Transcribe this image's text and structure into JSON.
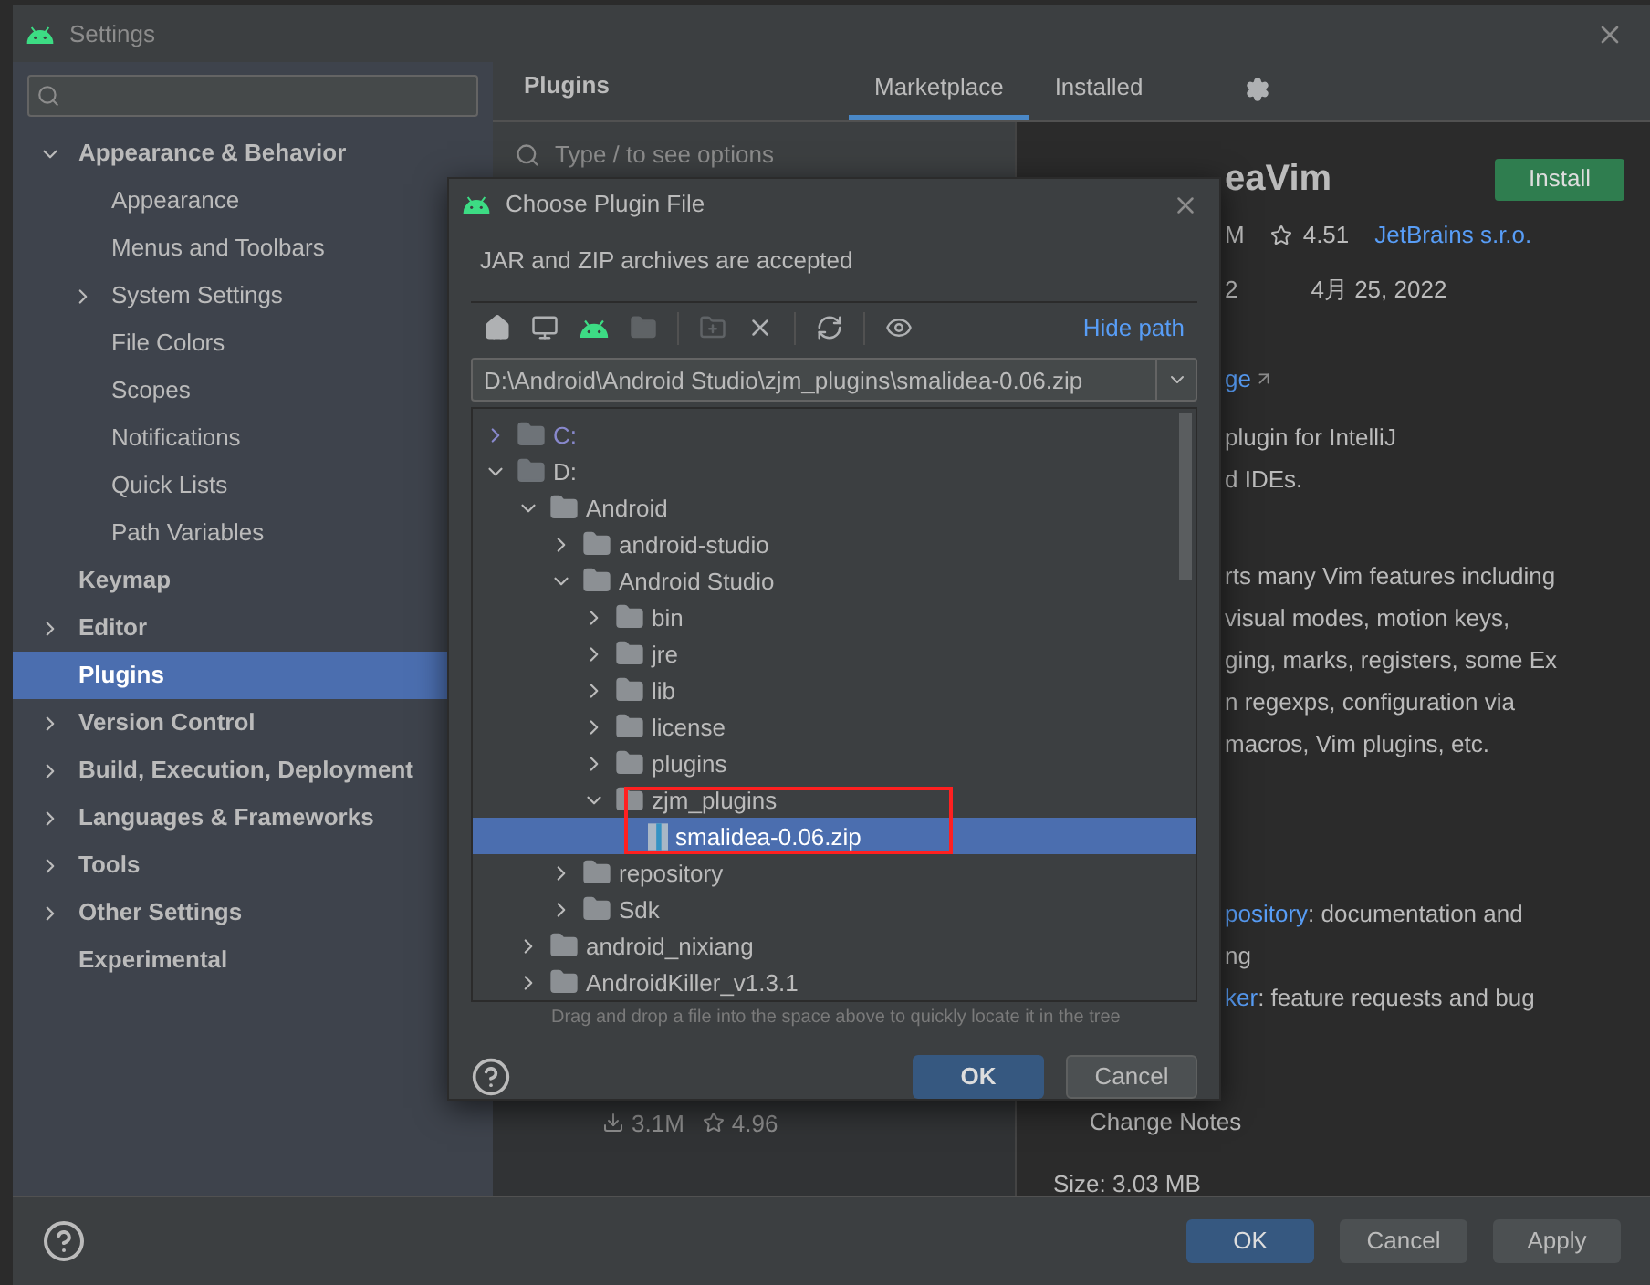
{
  "window": {
    "title": "Settings"
  },
  "sidebar": {
    "items": [
      {
        "label": "Appearance & Behavior",
        "expanded": true,
        "selected": false,
        "children": [
          {
            "label": "Appearance",
            "selected": false
          },
          {
            "label": "Menus and Toolbars",
            "selected": false
          },
          {
            "label": "System Settings",
            "expanded": false,
            "selected": false
          },
          {
            "label": "File Colors",
            "selected": false
          },
          {
            "label": "Scopes",
            "selected": false
          },
          {
            "label": "Notifications",
            "selected": false
          },
          {
            "label": "Quick Lists",
            "selected": false
          },
          {
            "label": "Path Variables",
            "selected": false
          }
        ]
      },
      {
        "label": "Keymap",
        "selected": false
      },
      {
        "label": "Editor",
        "expanded": false,
        "selected": false
      },
      {
        "label": "Plugins",
        "selected": true
      },
      {
        "label": "Version Control",
        "expanded": false,
        "selected": false
      },
      {
        "label": "Build, Execution, Deployment",
        "expanded": false,
        "selected": false
      },
      {
        "label": "Languages & Frameworks",
        "expanded": false,
        "selected": false
      },
      {
        "label": "Tools",
        "expanded": false,
        "selected": false
      },
      {
        "label": "Other Settings",
        "expanded": false,
        "selected": false
      },
      {
        "label": "Experimental",
        "selected": false
      }
    ]
  },
  "plugins": {
    "title": "Plugins",
    "tabs": [
      {
        "label": "Marketplace",
        "selected": true
      },
      {
        "label": "Installed",
        "selected": false
      }
    ],
    "search": {
      "placeholder": "Type / to see options"
    },
    "list_item": {
      "downloads": "3.1M",
      "rating": "4.96"
    }
  },
  "details": {
    "name": "eaVim",
    "install": "Install",
    "downloads": "M",
    "rating": "4.51",
    "vendor": "JetBrains s.r.o.",
    "version": "2",
    "date": "4月 25, 2022",
    "homepage_link": "ge",
    "desc_lines": [
      "plugin for IntelliJ",
      "d IDEs."
    ],
    "desc_lines_2": [
      "rts many Vim features including",
      "visual modes, motion keys,",
      "ging, marks, registers, some Ex",
      "n regexps, configuration via",
      "macros, Vim plugins, etc."
    ],
    "links": [
      {
        "link": "pository",
        "text": ": documentation and"
      },
      {
        "text": "ng"
      },
      {
        "link": "ker",
        "text": ": feature requests and bug"
      }
    ],
    "change_notes": "Change Notes",
    "size": "Size: 3.03 MB"
  },
  "dialog": {
    "title": "Choose Plugin File",
    "description": "JAR and ZIP archives are accepted",
    "toolbar": [
      {
        "kind": "home",
        "disabled": false
      },
      {
        "kind": "desktop",
        "disabled": false
      },
      {
        "kind": "android",
        "disabled": false
      },
      {
        "kind": "folder",
        "disabled": true
      },
      {
        "kind": "sep"
      },
      {
        "kind": "new-folder",
        "disabled": true
      },
      {
        "kind": "delete",
        "disabled": false
      },
      {
        "kind": "sep"
      },
      {
        "kind": "refresh",
        "disabled": false
      },
      {
        "kind": "sep"
      },
      {
        "kind": "show-hidden",
        "disabled": false
      }
    ],
    "hide_path": "Hide path",
    "path": "D:\\Android\\Android Studio\\zjm_plugins\\smalidea-0.06.zip",
    "tree": [
      {
        "label": "C:",
        "kind": "drive",
        "expanded": false,
        "selected": false
      },
      {
        "label": "D:",
        "kind": "drive",
        "expanded": true,
        "selected": false,
        "children": [
          {
            "label": "Android",
            "kind": "folder",
            "expanded": true,
            "selected": false,
            "children": [
              {
                "label": "android-studio",
                "kind": "folder",
                "expanded": false,
                "selected": false
              },
              {
                "label": "Android Studio",
                "kind": "folder",
                "expanded": true,
                "selected": false,
                "children": [
                  {
                    "label": "bin",
                    "kind": "folder",
                    "expanded": false,
                    "selected": false
                  },
                  {
                    "label": "jre",
                    "kind": "folder",
                    "expanded": false,
                    "selected": false
                  },
                  {
                    "label": "lib",
                    "kind": "folder",
                    "expanded": false,
                    "selected": false
                  },
                  {
                    "label": "license",
                    "kind": "folder",
                    "expanded": false,
                    "selected": false
                  },
                  {
                    "label": "plugins",
                    "kind": "folder",
                    "expanded": false,
                    "selected": false
                  },
                  {
                    "label": "zjm_plugins",
                    "kind": "folder",
                    "expanded": true,
                    "selected": false,
                    "children": [
                      {
                        "label": "smalidea-0.06.zip",
                        "kind": "archive",
                        "selected": true
                      }
                    ]
                  }
                ]
              },
              {
                "label": "repository",
                "kind": "folder",
                "expanded": false,
                "selected": false
              },
              {
                "label": "Sdk",
                "kind": "folder",
                "expanded": false,
                "selected": false
              }
            ]
          },
          {
            "label": "android_nixiang",
            "kind": "folder",
            "expanded": false,
            "selected": false
          },
          {
            "label": "AndroidKiller_v1.3.1",
            "kind": "folder",
            "expanded": false,
            "selected": false
          }
        ]
      }
    ],
    "hint": "Drag and drop a file into the space above to quickly locate it in the tree",
    "buttons": [
      {
        "label": "OK",
        "primary": true
      },
      {
        "label": "Cancel",
        "primary": false
      }
    ]
  },
  "buttons": [
    {
      "label": "OK",
      "primary": true
    },
    {
      "label": "Cancel",
      "primary": false
    },
    {
      "label": "Apply",
      "primary": false
    }
  ]
}
